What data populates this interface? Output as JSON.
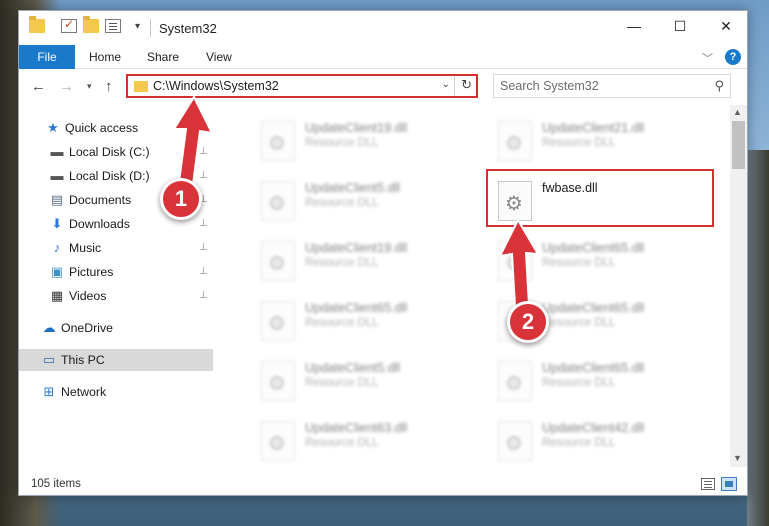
{
  "window": {
    "title": "System32",
    "minimize": "—",
    "maximize": "☐",
    "close": "✕"
  },
  "ribbon": {
    "tabs": [
      "File",
      "Home",
      "Share",
      "View"
    ],
    "collapse": "﹀",
    "help": "?"
  },
  "nav": {
    "back": "←",
    "forward": "→",
    "recent": "▾",
    "up": "↑",
    "address": "C:\\Windows\\System32",
    "address_dropdown": "⌄",
    "refresh": "↻",
    "search_placeholder": "Search System32",
    "search_icon": "⚲"
  },
  "sidebar": {
    "items": [
      {
        "label": "Quick access",
        "icon": "★",
        "icon_name": "star-icon",
        "color": "#2b78d6"
      },
      {
        "label": "Local Disk (C:)",
        "icon": "▬",
        "icon_name": "drive-icon",
        "color": "#555555",
        "pinned": true
      },
      {
        "label": "Local Disk (D:)",
        "icon": "▬",
        "icon_name": "drive-icon",
        "color": "#555555",
        "pinned": true
      },
      {
        "label": "Documents",
        "icon": "▤",
        "icon_name": "documents-icon",
        "color": "#5a6f86",
        "pinned": true
      },
      {
        "label": "Downloads",
        "icon": "⬇",
        "icon_name": "download-icon",
        "color": "#2b78d6",
        "pinned": true
      },
      {
        "label": "Music",
        "icon": "♪",
        "icon_name": "music-icon",
        "color": "#2b78d6",
        "pinned": true
      },
      {
        "label": "Pictures",
        "icon": "▣",
        "icon_name": "pictures-icon",
        "color": "#3f8fc9",
        "pinned": true
      },
      {
        "label": "Videos",
        "icon": "▦",
        "icon_name": "videos-icon",
        "color": "#333333",
        "pinned": true
      },
      {
        "label": "OneDrive",
        "icon": "☁",
        "icon_name": "cloud-icon",
        "color": "#1f6fc0"
      },
      {
        "label": "This PC",
        "icon": "▭",
        "icon_name": "computer-icon",
        "color": "#2b6fb2",
        "selected": true
      },
      {
        "label": "Network",
        "icon": "⊞",
        "icon_name": "network-icon",
        "color": "#2b78d6"
      }
    ],
    "pin_glyph": "📌"
  },
  "files": [
    {
      "name": "UpdateClient19.dll",
      "type": "Resource DLL",
      "blurred": true
    },
    {
      "name": "UpdateClient21.dll",
      "type": "Resource DLL",
      "blurred": true
    },
    {
      "name": "UpdateClient5.dll",
      "type": "Resource DLL",
      "blurred": true
    },
    {
      "name": "fwbase.dll",
      "type": "",
      "blurred": false
    },
    {
      "name": "UpdateClient19.dll",
      "type": "Resource DLL",
      "blurred": true
    },
    {
      "name": "UpdateClient65.dll",
      "type": "Resource DLL",
      "blurred": true
    },
    {
      "name": "UpdateClient65.dll",
      "type": "Resource DLL",
      "blurred": true
    },
    {
      "name": "UpdateClient65.dll",
      "type": "Resource DLL",
      "blurred": true
    },
    {
      "name": "UpdateClient5.dll",
      "type": "Resource DLL",
      "blurred": true
    },
    {
      "name": "UpdateClient65.dll",
      "type": "Resource DLL",
      "blurred": true
    },
    {
      "name": "UpdateClient63.dll",
      "type": "Resource DLL",
      "blurred": true
    },
    {
      "name": "UpdateClient42.dll",
      "type": "Resource DLL",
      "blurred": true
    }
  ],
  "scrollbar": {
    "up": "▲",
    "down": "▼"
  },
  "status": {
    "items_count": "105 items"
  },
  "annotations": {
    "badge1": "1",
    "badge2": "2",
    "accent": "#d9333a"
  }
}
